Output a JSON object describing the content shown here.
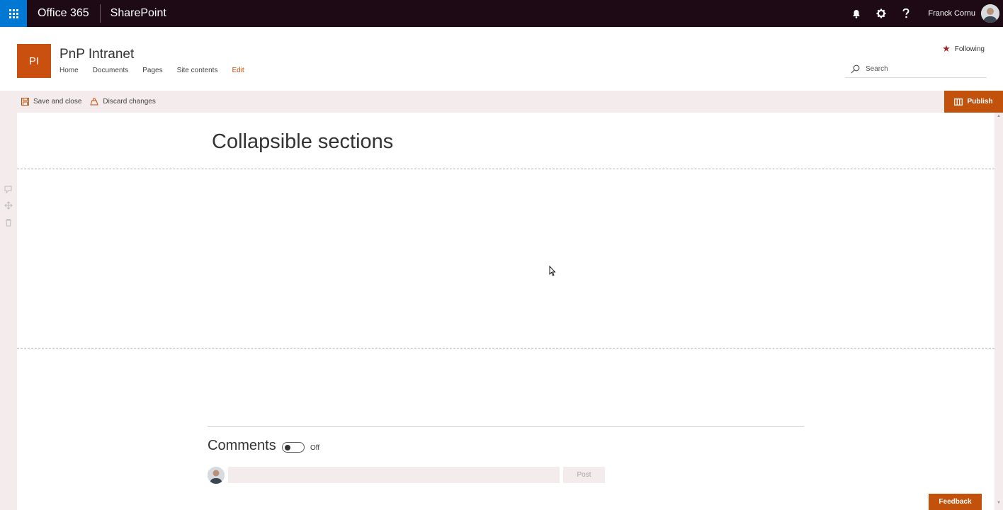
{
  "suite": {
    "brand": "Office 365",
    "app": "SharePoint",
    "user_name": "Franck Cornu",
    "icons": [
      "app-launcher-icon",
      "bell-icon",
      "gear-icon",
      "help-icon"
    ]
  },
  "site": {
    "logo_text": "PI",
    "title": "PnP Intranet",
    "nav": [
      "Home",
      "Documents",
      "Pages",
      "Site contents",
      "Edit"
    ],
    "following_label": "Following",
    "search_placeholder": "Search"
  },
  "commands": {
    "save_close": "Save and close",
    "discard": "Discard changes",
    "publish": "Publish"
  },
  "page": {
    "title": "Collapsible sections"
  },
  "comments": {
    "heading": "Comments",
    "toggle_state": "Off",
    "post_label": "Post"
  },
  "feedback_label": "Feedback",
  "colors": {
    "suite_bg": "#1d0a14",
    "waffle_bg": "#0078d4",
    "accent": "#ca5010",
    "command_bg": "#f4ebec"
  }
}
